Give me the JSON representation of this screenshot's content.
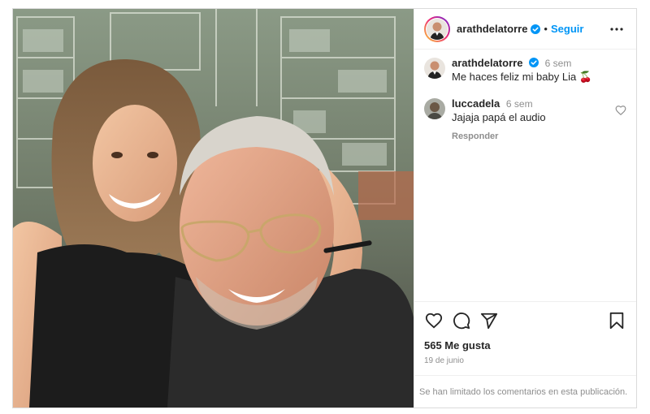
{
  "header": {
    "username": "arathdelatorre",
    "separator": "•",
    "follow_label": "Seguir",
    "more_icon": "more-horizontal-icon"
  },
  "colors": {
    "accent": "#0095f6",
    "secondary_text": "#8e8e8e",
    "primary_text": "#262626"
  },
  "comments": [
    {
      "username": "arathdelatorre",
      "time": "6 sem",
      "text": "Me haces feliz mi baby Lia 🍒",
      "verified": true
    },
    {
      "username": "luccadela",
      "time": "6 sem",
      "text": "Jajaja papá el audio",
      "reply_label": "Responder"
    }
  ],
  "actions": {
    "likes": "565 Me gusta",
    "date": "19 de junio"
  },
  "footer": {
    "notice": "Se han limitado los comentarios en esta publicación."
  }
}
